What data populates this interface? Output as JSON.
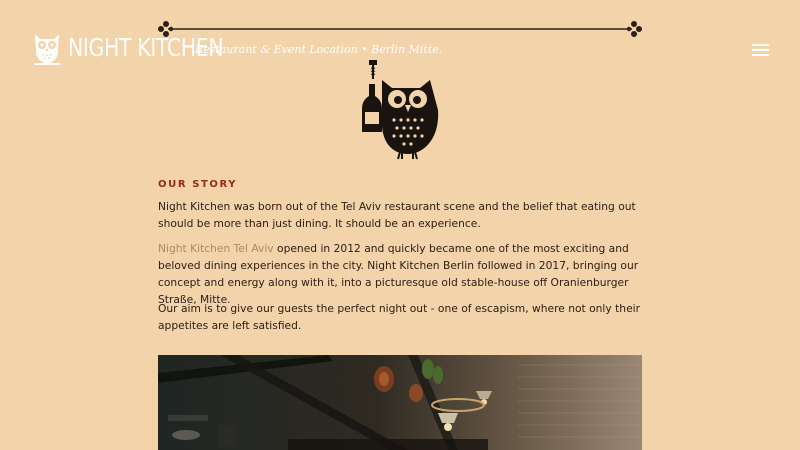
{
  "header": {
    "logo_text": "NIGHT KITCHEN",
    "tagline": "Restaurant & Event Location • Berlin Mitte."
  },
  "story": {
    "heading": "OUR STORY",
    "p1": "Night Kitchen was born out of the Tel Aviv restaurant scene and the belief that eating out should be more than just dining. It should be an experience.",
    "p2_link": "Night Kitchen Tel Aviv",
    "p2_rest": " opened in 2012 and quickly became one of the most exciting and beloved dining experiences in the city. Night Kitchen Berlin followed in 2017, bringing our concept and energy along with it, into a picturesque old stable-house off Oranienburger Straße, Mitte.",
    "p3": "Our aim is to give our guests the perfect night out - one of escapism, where not only their appetites are left satisfied."
  },
  "colors": {
    "background": "#f3d3a9",
    "heading": "#9a2a15",
    "link": "#a88c68",
    "text": "#2b2019"
  },
  "icons": {
    "logo": "owl-logo-icon",
    "menu": "hamburger-menu-icon",
    "illustration": "owl-with-bottle-icon"
  }
}
